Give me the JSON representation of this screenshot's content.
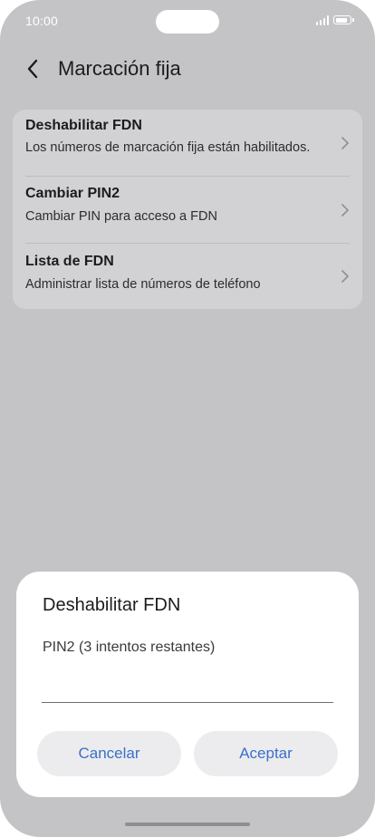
{
  "status_bar": {
    "time": "10:00"
  },
  "header": {
    "title": "Marcación fija"
  },
  "fdn_settings": {
    "items": [
      {
        "title": "Deshabilitar FDN",
        "subtitle": "Los números de marcación fija están habilitados."
      },
      {
        "title": "Cambiar PIN2",
        "subtitle": "Cambiar PIN para acceso a FDN"
      },
      {
        "title": "Lista de FDN",
        "subtitle": "Administrar lista de números de teléfono"
      }
    ]
  },
  "dialog": {
    "title": "Deshabilitar FDN",
    "pin_label": "PIN2 (3 intentos restantes)",
    "pin_value": "",
    "cancel_label": "Cancelar",
    "ok_label": "Aceptar"
  },
  "colors": {
    "accent": "#3b6fc8",
    "scrim": "#c4c4c6",
    "card": "#d2d2d4"
  },
  "icons": {
    "back": "chevron-left-icon",
    "row_arrow": "chevron-right-icon"
  }
}
